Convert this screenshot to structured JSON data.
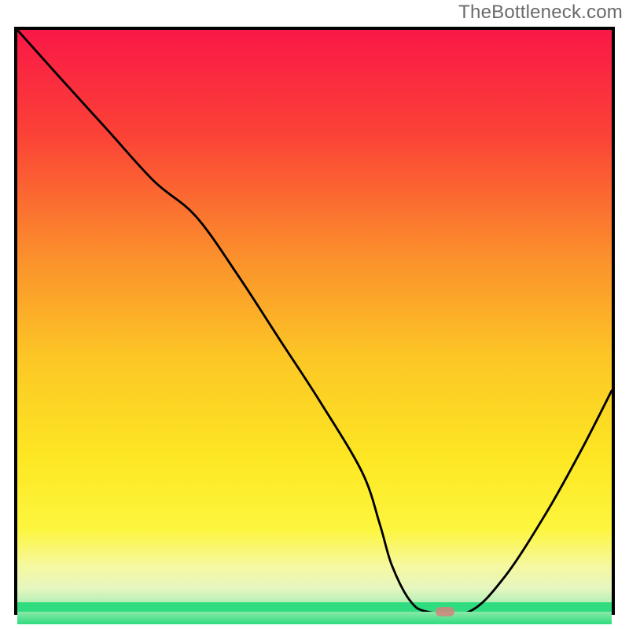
{
  "watermark": "TheBottleneck.com",
  "colors": {
    "frame": "#000000",
    "marker": "#d3847d",
    "bottom_accent": "#2fdc7f",
    "gradient_stops": [
      {
        "offset": 0.0,
        "color": "#fa1847"
      },
      {
        "offset": 0.18,
        "color": "#fb4336"
      },
      {
        "offset": 0.38,
        "color": "#fb8f2c"
      },
      {
        "offset": 0.55,
        "color": "#fcc625"
      },
      {
        "offset": 0.72,
        "color": "#fde723"
      },
      {
        "offset": 0.84,
        "color": "#fdf63e"
      },
      {
        "offset": 0.9,
        "color": "#f6f89d"
      },
      {
        "offset": 0.94,
        "color": "#e6f6c0"
      },
      {
        "offset": 0.975,
        "color": "#9cecb0"
      },
      {
        "offset": 1.0,
        "color": "#2fdc7f"
      }
    ]
  },
  "chart_data": {
    "type": "line",
    "title": "",
    "xlabel": "",
    "ylabel": "",
    "xlim": [
      0,
      100
    ],
    "ylim": [
      0,
      100
    ],
    "x": [
      0,
      7,
      15,
      23,
      30,
      37,
      44,
      51,
      58,
      61,
      63,
      66,
      69,
      76,
      82,
      89,
      95,
      100
    ],
    "values": [
      100,
      92,
      83,
      74,
      68,
      58,
      47,
      36,
      24,
      15,
      8,
      2,
      0,
      0,
      6,
      17,
      28,
      38
    ],
    "series": [
      {
        "name": "bottleneck-curve",
        "values": [
          100,
          92,
          83,
          74,
          68,
          58,
          47,
          36,
          24,
          15,
          8,
          2,
          0,
          0,
          6,
          17,
          28,
          38
        ]
      }
    ],
    "marker": {
      "x": 72,
      "y": 0
    }
  }
}
